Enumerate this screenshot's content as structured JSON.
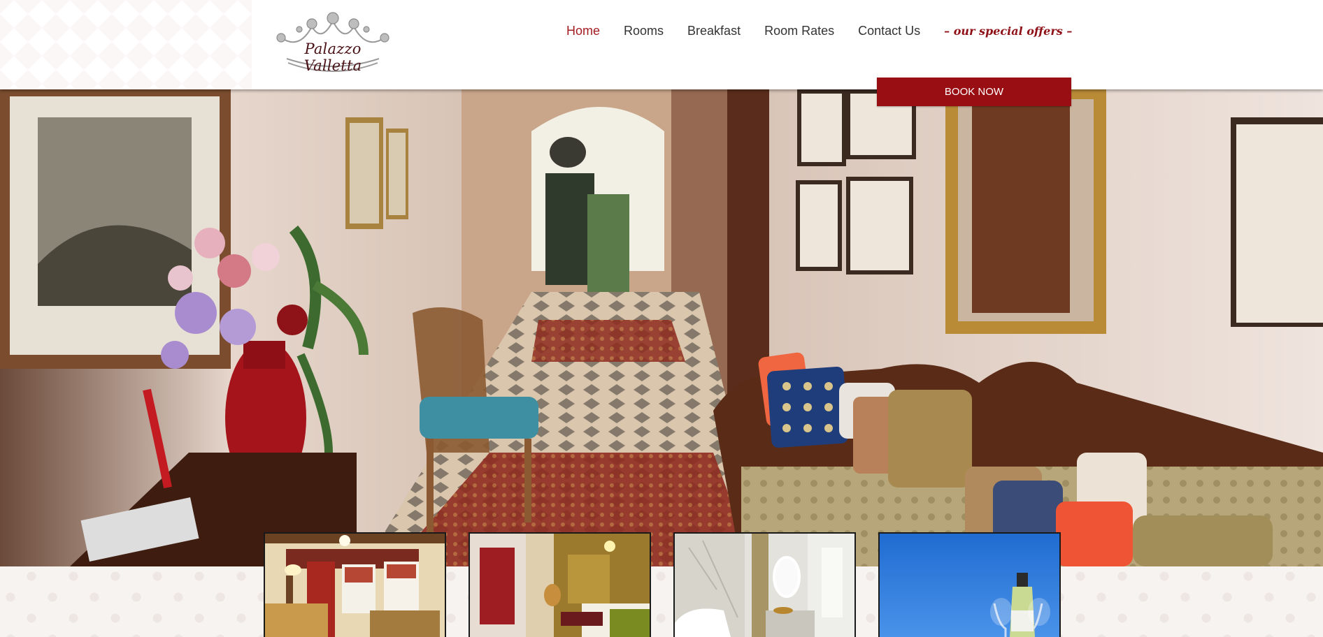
{
  "brand": {
    "logo_text": "Palazzo Valletta",
    "accent_color": "#980e12",
    "active_nav_color": "#a31c22"
  },
  "nav": {
    "items": [
      {
        "label": "Home",
        "active": true
      },
      {
        "label": "Rooms",
        "active": false
      },
      {
        "label": "Breakfast",
        "active": false
      },
      {
        "label": "Room Rates",
        "active": false
      },
      {
        "label": "Contact Us",
        "active": false
      }
    ],
    "special_offers_label": "– our special offers –"
  },
  "cta": {
    "book_now_label": "BOOK NOW"
  },
  "hero": {
    "icon": "hallway-photo"
  },
  "thumbnails": [
    {
      "icon": "bedroom-photo"
    },
    {
      "icon": "suite-photo"
    },
    {
      "icon": "bathroom-photo"
    },
    {
      "icon": "wine-photo"
    }
  ]
}
